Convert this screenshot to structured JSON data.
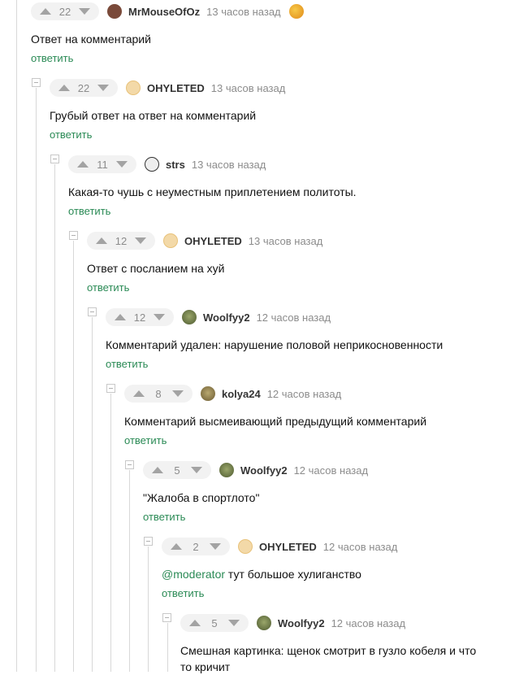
{
  "reply_label": "ответить",
  "comments": [
    {
      "rating": "22",
      "user": "MrMouseOfOz",
      "time": "13 часов назад",
      "text": "Ответ на комментарий",
      "avatar_color": "#7a4a3a"
    },
    {
      "rating": "22",
      "user": "OHYLETED",
      "time": "13 часов назад",
      "text": "Грубый ответ на ответ на комментарий",
      "avatar_color": "#f3c37a"
    },
    {
      "rating": "11",
      "user": "strs",
      "time": "13 часов назад",
      "text": "Какая-то чушь с неуместным приплетением политоты.",
      "avatar_color": "#333333"
    },
    {
      "rating": "12",
      "user": "OHYLETED",
      "time": "13 часов назад",
      "text": "Ответ с посланием на хуй",
      "avatar_color": "#f3c37a"
    },
    {
      "rating": "12",
      "user": "Woolfyy2",
      "time": "12 часов назад",
      "text": "Комментарий удален: нарушение половой неприкосновенности",
      "avatar_color": "#6b7a4a"
    },
    {
      "rating": "8",
      "user": "kolya24",
      "time": "12 часов назад",
      "text": "Комментарий высмеивающий предыдущий комментарий",
      "avatar_color": "#8a7a4a"
    },
    {
      "rating": "5",
      "user": "Woolfyy2",
      "time": "12 часов назад",
      "text": "\"Жалоба в спортлото\"",
      "avatar_color": "#6b7a4a"
    },
    {
      "rating": "2",
      "user": "OHYLETED",
      "time": "12 часов назад",
      "mention": "@moderator",
      "text": " тут большое хулиганство",
      "avatar_color": "#f3c37a"
    },
    {
      "rating": "5",
      "user": "Woolfyy2",
      "time": "12 часов назад",
      "text": "Смешная картинка: щенок смотрит в гузло кобеля и что то кричит",
      "avatar_color": "#6b7a4a"
    }
  ],
  "colors": {
    "accent": "#2a8a55",
    "muted": "#8c8c8c",
    "vote_bg": "#f2f2f2"
  }
}
